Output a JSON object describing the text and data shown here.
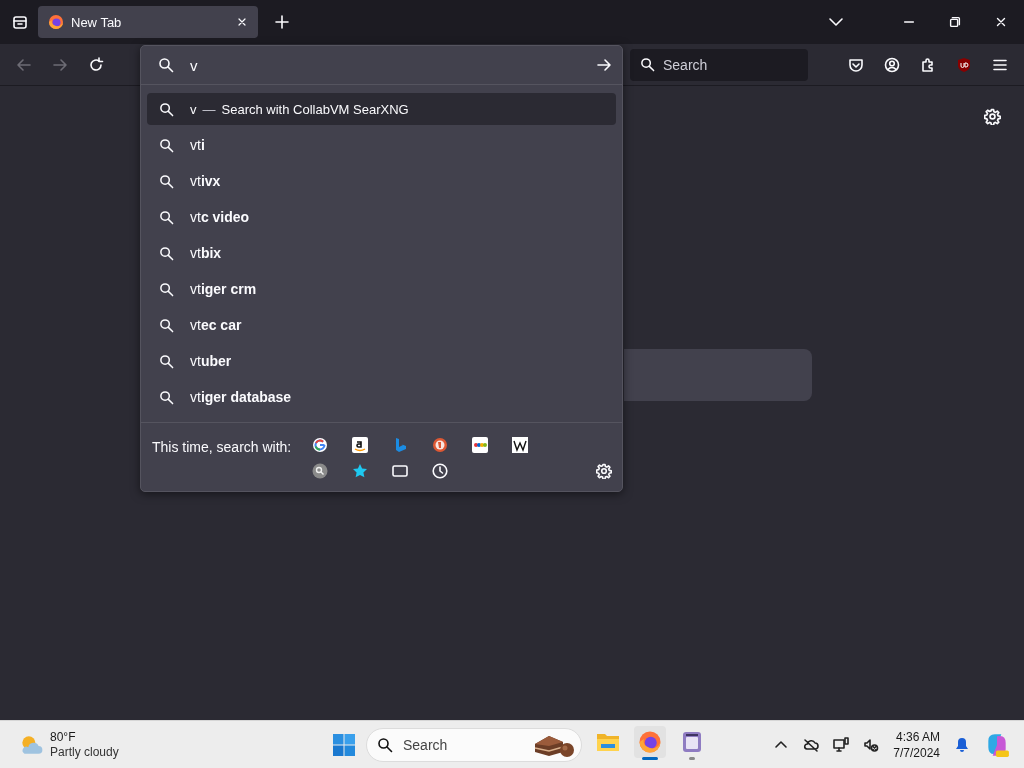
{
  "tabs": [
    {
      "title": "New Tab",
      "selected": true
    }
  ],
  "toolbar": {
    "search_placeholder": "Search"
  },
  "urlbar": {
    "value": "v"
  },
  "suggestions": [
    {
      "kind": "engine",
      "text": "v",
      "separator": "—",
      "action": "Search with CollabVM SearXNG",
      "selected": true
    },
    {
      "kind": "query",
      "text": "vt**i**",
      "selected": false
    },
    {
      "kind": "query",
      "text": "vt**ivx**",
      "selected": false
    },
    {
      "kind": "query",
      "text": "vt**c video**",
      "selected": false
    },
    {
      "kind": "query",
      "text": "vt**bix**",
      "selected": false
    },
    {
      "kind": "query",
      "text": "vt**iger crm**",
      "selected": false
    },
    {
      "kind": "query",
      "text": "vt**ec car**",
      "selected": false
    },
    {
      "kind": "query",
      "text": "vt**uber**",
      "selected": false
    },
    {
      "kind": "query",
      "text": "vt**iger database**",
      "selected": false
    }
  ],
  "search_with": {
    "label": "This time, search with:"
  },
  "taskbar": {
    "weather": {
      "temperature": "80°F",
      "condition": "Partly cloudy"
    },
    "search_placeholder": "Search",
    "apps": [
      {
        "selected": false,
        "running": false
      },
      {
        "selected": true,
        "running": true
      },
      {
        "selected": false,
        "running": true
      }
    ],
    "time": "4:36 AM",
    "date": "7/7/2024"
  }
}
